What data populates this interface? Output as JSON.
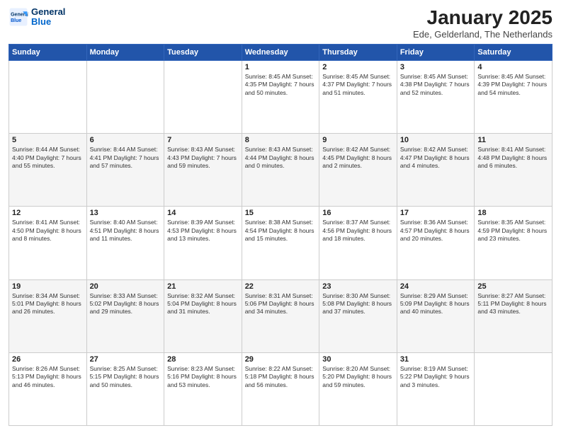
{
  "header": {
    "logo_line1": "General",
    "logo_line2": "Blue",
    "month": "January 2025",
    "location": "Ede, Gelderland, The Netherlands"
  },
  "weekdays": [
    "Sunday",
    "Monday",
    "Tuesday",
    "Wednesday",
    "Thursday",
    "Friday",
    "Saturday"
  ],
  "weeks": [
    [
      {
        "day": "",
        "info": ""
      },
      {
        "day": "",
        "info": ""
      },
      {
        "day": "",
        "info": ""
      },
      {
        "day": "1",
        "info": "Sunrise: 8:45 AM\nSunset: 4:35 PM\nDaylight: 7 hours\nand 50 minutes."
      },
      {
        "day": "2",
        "info": "Sunrise: 8:45 AM\nSunset: 4:37 PM\nDaylight: 7 hours\nand 51 minutes."
      },
      {
        "day": "3",
        "info": "Sunrise: 8:45 AM\nSunset: 4:38 PM\nDaylight: 7 hours\nand 52 minutes."
      },
      {
        "day": "4",
        "info": "Sunrise: 8:45 AM\nSunset: 4:39 PM\nDaylight: 7 hours\nand 54 minutes."
      }
    ],
    [
      {
        "day": "5",
        "info": "Sunrise: 8:44 AM\nSunset: 4:40 PM\nDaylight: 7 hours\nand 55 minutes."
      },
      {
        "day": "6",
        "info": "Sunrise: 8:44 AM\nSunset: 4:41 PM\nDaylight: 7 hours\nand 57 minutes."
      },
      {
        "day": "7",
        "info": "Sunrise: 8:43 AM\nSunset: 4:43 PM\nDaylight: 7 hours\nand 59 minutes."
      },
      {
        "day": "8",
        "info": "Sunrise: 8:43 AM\nSunset: 4:44 PM\nDaylight: 8 hours\nand 0 minutes."
      },
      {
        "day": "9",
        "info": "Sunrise: 8:42 AM\nSunset: 4:45 PM\nDaylight: 8 hours\nand 2 minutes."
      },
      {
        "day": "10",
        "info": "Sunrise: 8:42 AM\nSunset: 4:47 PM\nDaylight: 8 hours\nand 4 minutes."
      },
      {
        "day": "11",
        "info": "Sunrise: 8:41 AM\nSunset: 4:48 PM\nDaylight: 8 hours\nand 6 minutes."
      }
    ],
    [
      {
        "day": "12",
        "info": "Sunrise: 8:41 AM\nSunset: 4:50 PM\nDaylight: 8 hours\nand 8 minutes."
      },
      {
        "day": "13",
        "info": "Sunrise: 8:40 AM\nSunset: 4:51 PM\nDaylight: 8 hours\nand 11 minutes."
      },
      {
        "day": "14",
        "info": "Sunrise: 8:39 AM\nSunset: 4:53 PM\nDaylight: 8 hours\nand 13 minutes."
      },
      {
        "day": "15",
        "info": "Sunrise: 8:38 AM\nSunset: 4:54 PM\nDaylight: 8 hours\nand 15 minutes."
      },
      {
        "day": "16",
        "info": "Sunrise: 8:37 AM\nSunset: 4:56 PM\nDaylight: 8 hours\nand 18 minutes."
      },
      {
        "day": "17",
        "info": "Sunrise: 8:36 AM\nSunset: 4:57 PM\nDaylight: 8 hours\nand 20 minutes."
      },
      {
        "day": "18",
        "info": "Sunrise: 8:35 AM\nSunset: 4:59 PM\nDaylight: 8 hours\nand 23 minutes."
      }
    ],
    [
      {
        "day": "19",
        "info": "Sunrise: 8:34 AM\nSunset: 5:01 PM\nDaylight: 8 hours\nand 26 minutes."
      },
      {
        "day": "20",
        "info": "Sunrise: 8:33 AM\nSunset: 5:02 PM\nDaylight: 8 hours\nand 29 minutes."
      },
      {
        "day": "21",
        "info": "Sunrise: 8:32 AM\nSunset: 5:04 PM\nDaylight: 8 hours\nand 31 minutes."
      },
      {
        "day": "22",
        "info": "Sunrise: 8:31 AM\nSunset: 5:06 PM\nDaylight: 8 hours\nand 34 minutes."
      },
      {
        "day": "23",
        "info": "Sunrise: 8:30 AM\nSunset: 5:08 PM\nDaylight: 8 hours\nand 37 minutes."
      },
      {
        "day": "24",
        "info": "Sunrise: 8:29 AM\nSunset: 5:09 PM\nDaylight: 8 hours\nand 40 minutes."
      },
      {
        "day": "25",
        "info": "Sunrise: 8:27 AM\nSunset: 5:11 PM\nDaylight: 8 hours\nand 43 minutes."
      }
    ],
    [
      {
        "day": "26",
        "info": "Sunrise: 8:26 AM\nSunset: 5:13 PM\nDaylight: 8 hours\nand 46 minutes."
      },
      {
        "day": "27",
        "info": "Sunrise: 8:25 AM\nSunset: 5:15 PM\nDaylight: 8 hours\nand 50 minutes."
      },
      {
        "day": "28",
        "info": "Sunrise: 8:23 AM\nSunset: 5:16 PM\nDaylight: 8 hours\nand 53 minutes."
      },
      {
        "day": "29",
        "info": "Sunrise: 8:22 AM\nSunset: 5:18 PM\nDaylight: 8 hours\nand 56 minutes."
      },
      {
        "day": "30",
        "info": "Sunrise: 8:20 AM\nSunset: 5:20 PM\nDaylight: 8 hours\nand 59 minutes."
      },
      {
        "day": "31",
        "info": "Sunrise: 8:19 AM\nSunset: 5:22 PM\nDaylight: 9 hours\nand 3 minutes."
      },
      {
        "day": "",
        "info": ""
      }
    ]
  ]
}
